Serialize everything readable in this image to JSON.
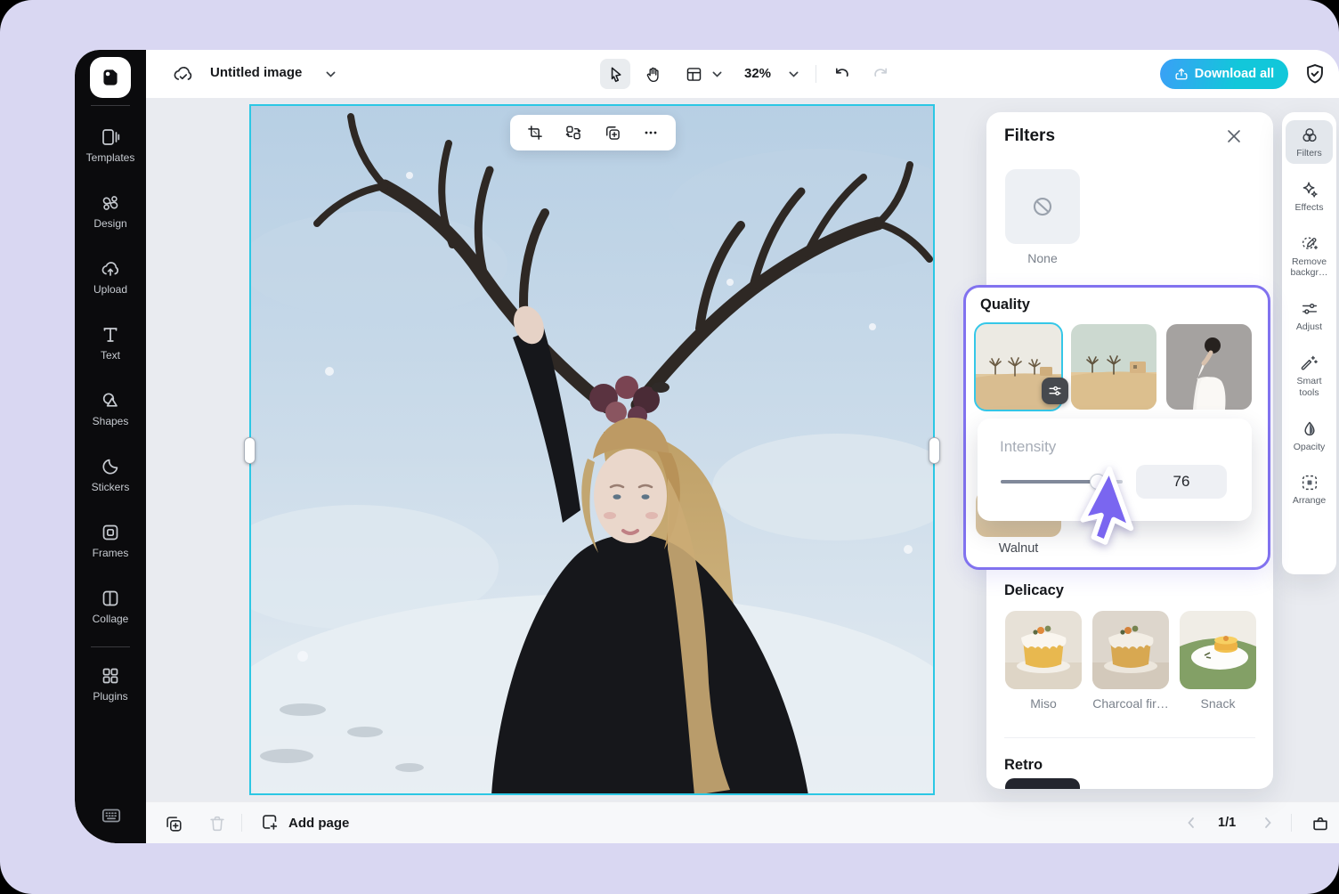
{
  "topbar": {
    "title": "Untitled image",
    "zoom_value": "32%",
    "download_label": "Download all"
  },
  "sidebar": {
    "items": [
      {
        "label": "Templates"
      },
      {
        "label": "Design"
      },
      {
        "label": "Upload"
      },
      {
        "label": "Text"
      },
      {
        "label": "Shapes"
      },
      {
        "label": "Stickers"
      },
      {
        "label": "Frames"
      },
      {
        "label": "Collage"
      },
      {
        "label": "Plugins"
      }
    ]
  },
  "filters_panel": {
    "title": "Filters",
    "none_label": "None",
    "quality": {
      "title": "Quality",
      "selected_label": "Walnut",
      "intensity_label": "Intensity",
      "intensity_value": "76"
    },
    "delicacy": {
      "title": "Delicacy",
      "items": [
        {
          "label": "Miso"
        },
        {
          "label": "Charcoal fir…"
        },
        {
          "label": "Snack"
        }
      ]
    },
    "retro": {
      "title": "Retro"
    }
  },
  "right_toolbar": {
    "active": "Filters",
    "items": [
      {
        "label": "Filters"
      },
      {
        "label": "Effects"
      },
      {
        "label": "Remove backgr…"
      },
      {
        "label": "Adjust"
      },
      {
        "label": "Smart tools"
      },
      {
        "label": "Opacity"
      },
      {
        "label": "Arrange"
      }
    ]
  },
  "bottombar": {
    "add_page_label": "Add page",
    "pagination": "1/1"
  },
  "colors": {
    "accent_purple": "#8172ef",
    "selection_cyan": "#2cc7e4",
    "download_gradient_start": "#3aa0f6",
    "download_gradient_end": "#12c7da",
    "page_background": "#d9d7f2",
    "sidebar_background": "#0b0b0d"
  }
}
